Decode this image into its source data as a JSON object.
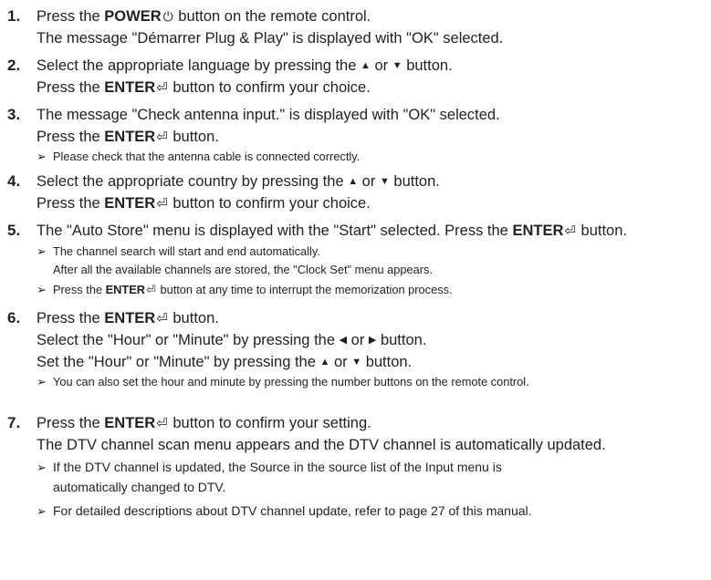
{
  "steps": [
    {
      "number": "1.",
      "lines": [
        {
          "pre": "Press the ",
          "bold": "POWER",
          "post": " button on the remote control.",
          "icon": "power-icon"
        },
        {
          "text": "The message \"Démarrer Plug & Play\" is displayed with \"OK\" selected."
        }
      ]
    },
    {
      "number": "2.",
      "lines": [
        {
          "pre": "Select the appropriate language by pressing the ",
          "or": " or ",
          "post": " button."
        },
        {
          "pre": "Press the ",
          "bold": "ENTER",
          "post": " button to confirm your choice.",
          "icon": "enter-icon"
        }
      ]
    },
    {
      "number": "3.",
      "lines": [
        {
          "text": "The message \"Check antenna input.\" is displayed with \"OK\" selected."
        },
        {
          "pre": "Press the ",
          "bold": "ENTER",
          "post": " button.",
          "icon": "enter-icon"
        }
      ],
      "notes": [
        "Please check that the antenna cable is connected correctly."
      ]
    },
    {
      "number": "4.",
      "lines": [
        {
          "pre": "Select the appropriate country by pressing the ",
          "or": " or ",
          "post": " button."
        },
        {
          "pre": "Press the ",
          "bold": "ENTER",
          "post": " button to confirm your choice.",
          "icon": "enter-icon"
        }
      ]
    },
    {
      "number": "5.",
      "lines": [
        {
          "pre": "The \"Auto Store\" menu is displayed with the \"Start\" selected. Press the ",
          "bold": "ENTER",
          "post": " button.",
          "icon": "enter-icon"
        }
      ],
      "notes": [
        "The channel search will start and end automatically.",
        "After all the available channels are stored, the \"Clock Set\" menu appears."
      ],
      "note2": {
        "pre": "Press the ",
        "bold": "ENTER",
        "post": " button at any time to interrupt the memorization process."
      }
    },
    {
      "number": "6.",
      "lines": [
        {
          "pre": "Press the ",
          "bold": "ENTER",
          "post": " button.",
          "icon": "enter-icon"
        },
        {
          "pre": "Select the \"Hour\" or \"Minute\" by pressing the ",
          "or": " or ",
          "post": " button."
        },
        {
          "pre": "Set the \"Hour\" or \"Minute\" by pressing the ",
          "or": " or ",
          "post": " button."
        }
      ],
      "notes": [
        "You can also set the hour and minute by pressing the number buttons on the remote control."
      ]
    },
    {
      "number": "7.",
      "lines": [
        {
          "pre": "Press the ",
          "bold": "ENTER",
          "post": " button to confirm your setting.",
          "icon": "enter-icon"
        },
        {
          "text": "The DTV channel scan menu appears and the DTV channel is automatically updated."
        }
      ],
      "notes": [
        "If the DTV channel is updated, the Source in the source list of the Input menu is",
        "automatically changed to DTV.",
        "For detailed descriptions about DTV channel update, refer to page 27 of this manual."
      ]
    }
  ]
}
